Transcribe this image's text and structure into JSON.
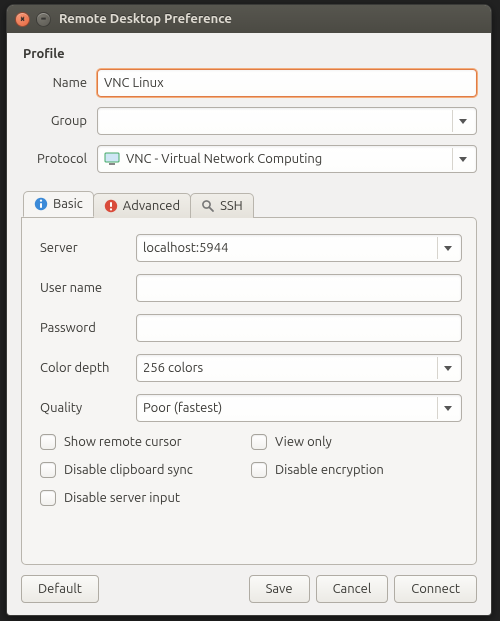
{
  "window": {
    "title": "Remote Desktop Preference"
  },
  "profile": {
    "section": "Profile",
    "name_label": "Name",
    "name_value": "VNC Linux",
    "group_label": "Group",
    "group_value": "",
    "protocol_label": "Protocol",
    "protocol_value": "VNC - Virtual Network Computing"
  },
  "tabs": {
    "basic": "Basic",
    "advanced": "Advanced",
    "ssh": "SSH"
  },
  "basic": {
    "server_label": "Server",
    "server_value": "localhost:5944",
    "username_label": "User name",
    "username_value": "",
    "password_label": "Password",
    "password_value": "",
    "color_label": "Color depth",
    "color_value": "256 colors",
    "quality_label": "Quality",
    "quality_value": "Poor (fastest)",
    "chk_remote_cursor": "Show remote cursor",
    "chk_view_only": "View only",
    "chk_clipboard": "Disable clipboard sync",
    "chk_encryption": "Disable encryption",
    "chk_server_input": "Disable server input"
  },
  "buttons": {
    "default": "Default",
    "save": "Save",
    "cancel": "Cancel",
    "connect": "Connect"
  }
}
